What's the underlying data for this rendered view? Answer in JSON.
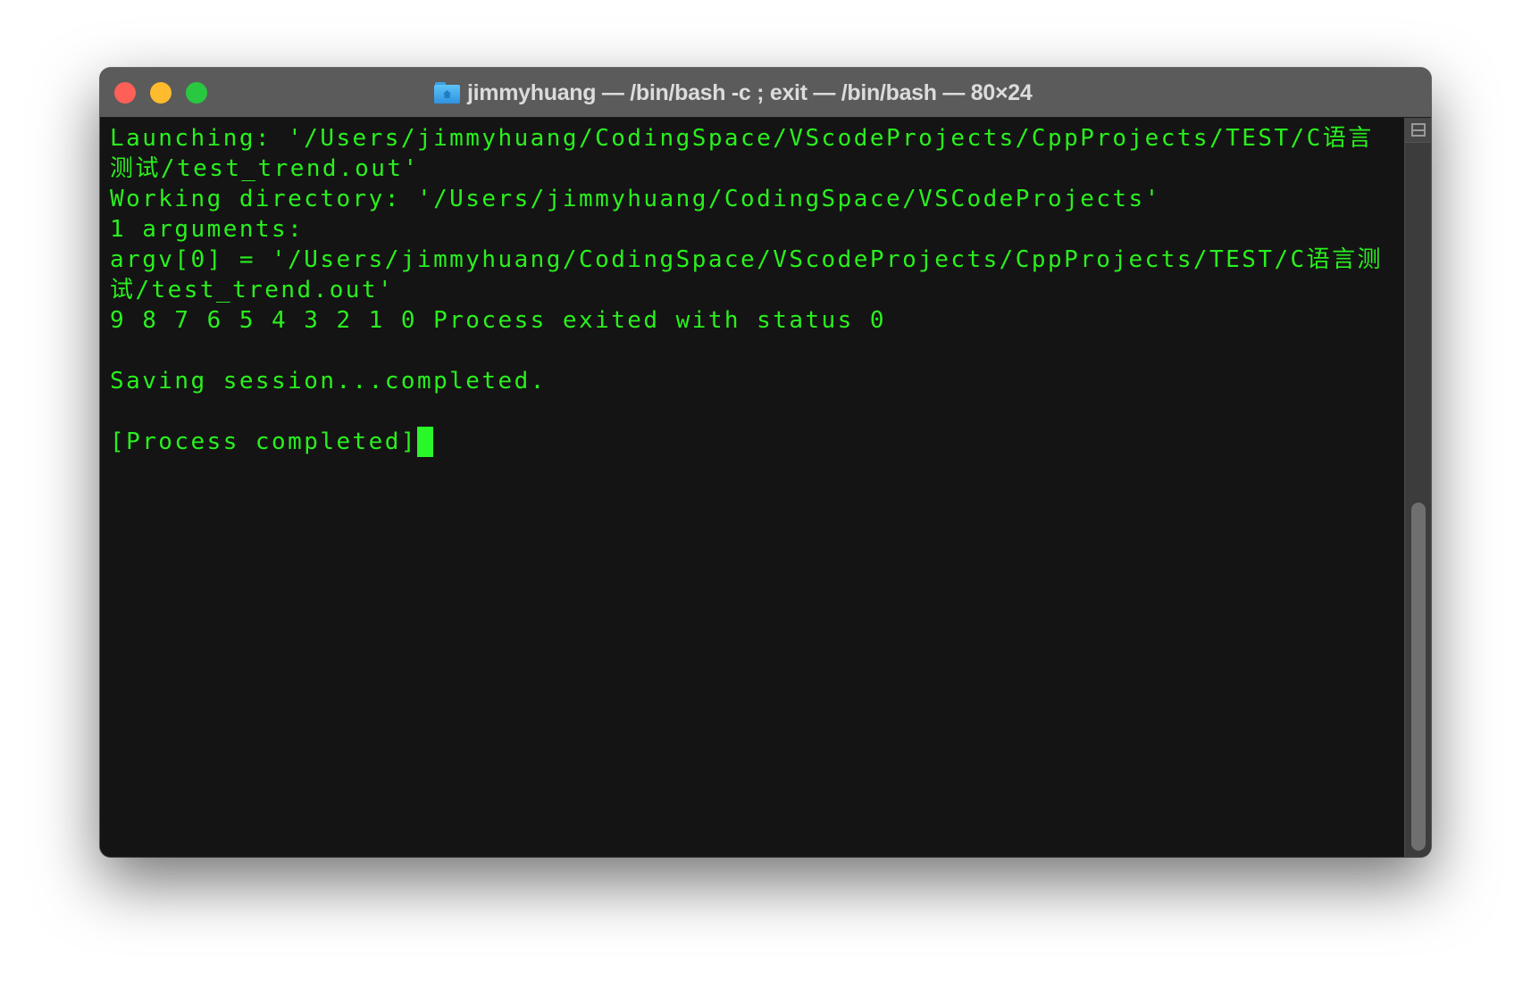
{
  "window": {
    "title": "jimmyhuang — /bin/bash -c ; exit — /bin/bash — 80×24",
    "title_icon": "home-folder-icon",
    "controls": {
      "close": "close-button",
      "minimize": "minimize-button",
      "zoom": "zoom-button"
    },
    "colors": {
      "close": "#fe5f57",
      "minimize": "#febb2e",
      "zoom": "#28c840",
      "titlebar": "#5b5b5b",
      "terminal_bg": "#141414",
      "terminal_text": "#2af01e",
      "cursor": "#2af72a"
    }
  },
  "terminal": {
    "lines": [
      "Launching: '/Users/jimmyhuang/CodingSpace/VScodeProjects/CppProjects/TEST/C语言",
      "测试/test_trend.out'",
      "Working directory: '/Users/jimmyhuang/CodingSpace/VSCodeProjects'",
      "1 arguments:",
      "argv[0] = '/Users/jimmyhuang/CodingSpace/VScodeProjects/CppProjects/TEST/C语言测",
      "试/test_trend.out'",
      "9 8 7 6 5 4 3 2 1 0 Process exited with status 0",
      "",
      "Saving session...completed.",
      "",
      "[Process completed]"
    ]
  },
  "scrollbar": {
    "split_icon": "split-pane-icon"
  }
}
